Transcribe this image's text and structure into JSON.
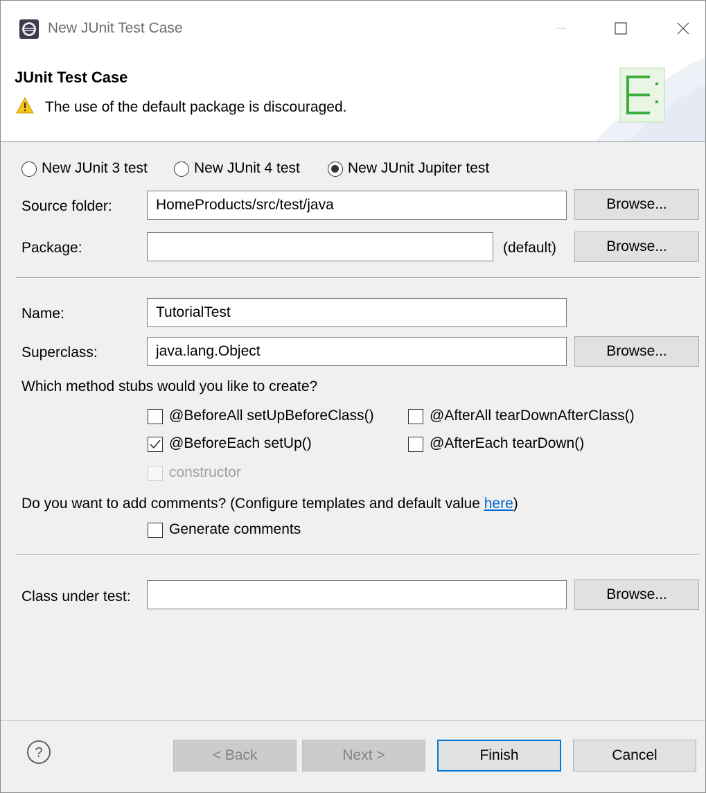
{
  "window": {
    "title": "New JUnit Test Case"
  },
  "banner": {
    "title": "JUnit Test Case",
    "message": "The use of the default package is discouraged."
  },
  "version_options": [
    {
      "label": "New JUnit 3 test",
      "selected": false
    },
    {
      "label": "New JUnit 4 test",
      "selected": false
    },
    {
      "label": "New JUnit Jupiter test",
      "selected": true
    }
  ],
  "source_folder": {
    "label": "Source folder:",
    "value": "HomeProducts/src/test/java",
    "browse": "Browse..."
  },
  "package": {
    "label": "Package:",
    "value": "",
    "suffix": "(default)",
    "browse": "Browse..."
  },
  "name": {
    "label": "Name:",
    "value": "TutorialTest"
  },
  "superclass": {
    "label": "Superclass:",
    "value": "java.lang.Object",
    "browse": "Browse..."
  },
  "stubs": {
    "question": "Which method stubs would you like to create?",
    "before_all": {
      "label": "@BeforeAll setUpBeforeClass()",
      "checked": false
    },
    "after_all": {
      "label": "@AfterAll tearDownAfterClass()",
      "checked": false
    },
    "before_each": {
      "label": "@BeforeEach setUp()",
      "checked": true
    },
    "after_each": {
      "label": "@AfterEach tearDown()",
      "checked": false
    },
    "constructor": {
      "label": "constructor",
      "checked": false,
      "enabled": false
    }
  },
  "comments": {
    "question_prefix": "Do you want to add comments? (Configure templates and default value ",
    "link": "here",
    "question_suffix": ")",
    "generate": {
      "label": "Generate comments",
      "checked": false
    }
  },
  "class_under_test": {
    "label": "Class under test:",
    "value": "",
    "browse": "Browse..."
  },
  "footer": {
    "back": "< Back",
    "next": "Next >",
    "finish": "Finish",
    "cancel": "Cancel"
  }
}
